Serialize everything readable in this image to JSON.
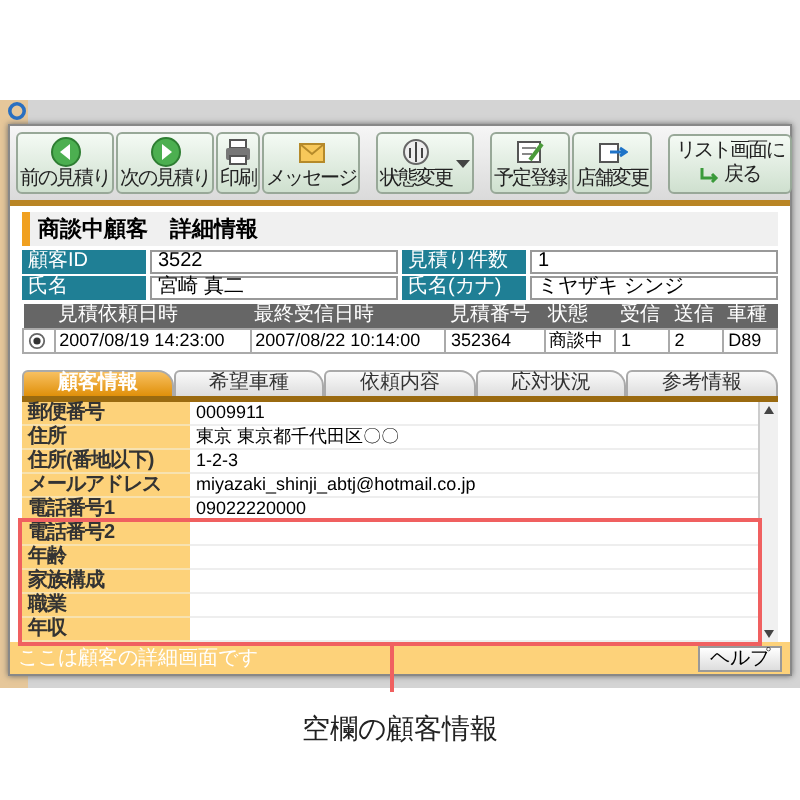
{
  "toolbar": {
    "groups": [
      [
        {
          "label": "前の見積り",
          "has_menu": false
        },
        {
          "label": "次の見積り",
          "has_menu": false
        },
        {
          "label": "印刷",
          "has_menu": false
        },
        {
          "label": "メッセージ",
          "has_menu": false
        }
      ],
      [
        {
          "label": "状態変更",
          "has_menu": true
        }
      ],
      [
        {
          "label": "予定登録",
          "has_menu": false
        },
        {
          "label": "店舗変更",
          "has_menu": false
        }
      ]
    ],
    "return_button": {
      "label_lines": [
        "リスト画面に",
        "戻る"
      ]
    }
  },
  "heading": "商談中顧客　詳細情報",
  "info_fields": [
    {
      "label": "顧客ID",
      "value": "3522"
    },
    {
      "label": "見積り件数",
      "value": "1"
    },
    {
      "label": "氏名",
      "value": "宮崎 真二"
    },
    {
      "label": "氏名(カナ)",
      "value": "ミヤザキ シンジ"
    }
  ],
  "quotes_table": {
    "columns": [
      "見積依頼日時",
      "最終受信日時",
      "見積番号",
      "状態",
      "受信",
      "送信",
      "車種"
    ],
    "rows": [
      {
        "selected": true,
        "cells": [
          "2007/08/19 14:23:00",
          "2007/08/22 10:14:00",
          "352364",
          "商談中",
          "1",
          "2",
          "D89"
        ]
      }
    ]
  },
  "tabs": [
    {
      "label": "顧客情報",
      "selected": true
    },
    {
      "label": "希望車種",
      "selected": false
    },
    {
      "label": "依頼内容",
      "selected": false
    },
    {
      "label": "応対状況",
      "selected": false
    },
    {
      "label": "参考情報",
      "selected": false
    }
  ],
  "detail_rows": [
    {
      "label": "郵便番号",
      "value": "0009911",
      "highlighted": false
    },
    {
      "label": "住所",
      "value": "東京 東京都千代田区〇〇",
      "highlighted": false
    },
    {
      "label": "住所(番地以下)",
      "value": "1-2-3",
      "highlighted": false
    },
    {
      "label": "メールアドレス",
      "value": "miyazaki_shinji_abtj@hotmail.co.jp",
      "highlighted": false
    },
    {
      "label": "電話番号1",
      "value": "09022220000",
      "highlighted": false
    },
    {
      "label": "電話番号2",
      "highlighted": true
    },
    {
      "label": "年齢",
      "highlighted": true
    },
    {
      "label": "家族構成",
      "highlighted": true
    },
    {
      "label": "職業",
      "highlighted": true
    },
    {
      "label": "年収",
      "highlighted": true
    }
  ],
  "footer": {
    "status": "ここは顧客の詳細画面です",
    "help_button": "ヘルプ"
  },
  "annotation": {
    "caption": "空欄の顧客情報"
  }
}
